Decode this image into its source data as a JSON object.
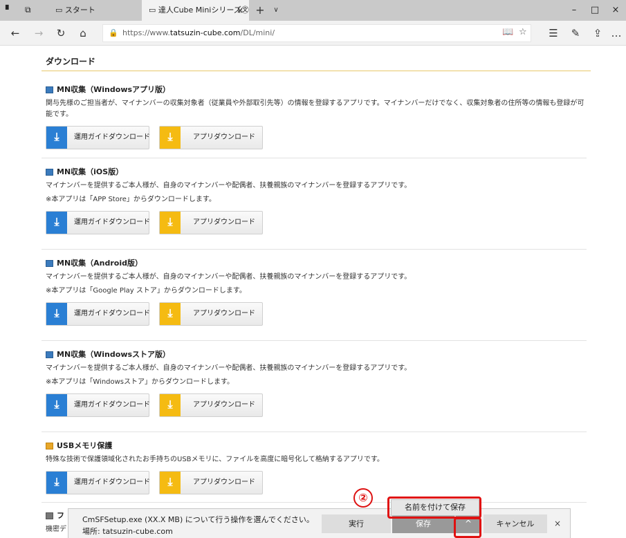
{
  "tabbar": {
    "start_tab": "スタート",
    "active_tab": "達人Cube Miniシリーズ㉆",
    "new_tab": "+",
    "tab_menu": "∨",
    "close_tab": "×"
  },
  "window": {
    "minimize": "–",
    "maximize": "□",
    "close": "×"
  },
  "addrbar": {
    "url_prefix": "https://www.",
    "url_host": "tatsuzin-cube.com",
    "url_path": "/DL/mini/"
  },
  "page": {
    "title": "ダウンロード",
    "sections": [
      {
        "heading": "MN収集（Windowsアプリ版）",
        "lines": [
          "関与先様のご担当者が、マイナンバーの収集対象者（従業員や外部取引先等）の情報を登録するアプリです。マイナンバーだけでなく、収集対象者の住所等の情報も登録が可",
          "能です。"
        ],
        "guide_button": "運用ガイドダウンロード",
        "app_button": "アプリダウンロード"
      },
      {
        "heading": "MN収集（iOS版）",
        "lines": [
          "マイナンバーを提供するご本人様が、自身のマイナンバーや配偶者、扶養親族のマイナンバーを登録するアプリです。",
          "※本アプリは「APP Store」からダウンロードします。"
        ],
        "guide_button": "運用ガイドダウンロード",
        "app_button": "アプリダウンロード"
      },
      {
        "heading": "MN収集（Android版）",
        "lines": [
          "マイナンバーを提供するご本人様が、自身のマイナンバーや配偶者、扶養親族のマイナンバーを登録するアプリです。",
          "※本アプリは「Google Play ストア」からダウンロードします。"
        ],
        "guide_button": "運用ガイドダウンロード",
        "app_button": "アプリダウンロード"
      },
      {
        "heading": "MN収集（Windowsストア版）",
        "lines": [
          "マイナンバーを提供するご本人様が、自身のマイナンバーや配偶者、扶養親族のマイナンバーを登録するアプリです。",
          "※本アプリは「Windowsストア」からダウンロードします。"
        ],
        "guide_button": "運用ガイドダウンロード",
        "app_button": "アプリダウンロード"
      },
      {
        "heading": "USBメモリ保護",
        "lines": [
          "特殊な技術で保護領域化されたお手持ちのUSBメモリに、ファイルを高度に暗号化して格納するアプリです。"
        ],
        "guide_button": "運用ガイドダウンロード",
        "app_button": "アプリダウンロード"
      }
    ],
    "partial_heading": "フ",
    "partial_line": "機密デ"
  },
  "download_bar": {
    "message": "CmSFSetup.exe (XX.X MB) について行う操作を選んでください。",
    "source": "場所: tatsuzin-cube.com",
    "run": "実行",
    "save": "保存",
    "more": "^",
    "cancel": "キャンセル",
    "close": "×",
    "save_as": "名前を付けて保存"
  },
  "callout": "②"
}
